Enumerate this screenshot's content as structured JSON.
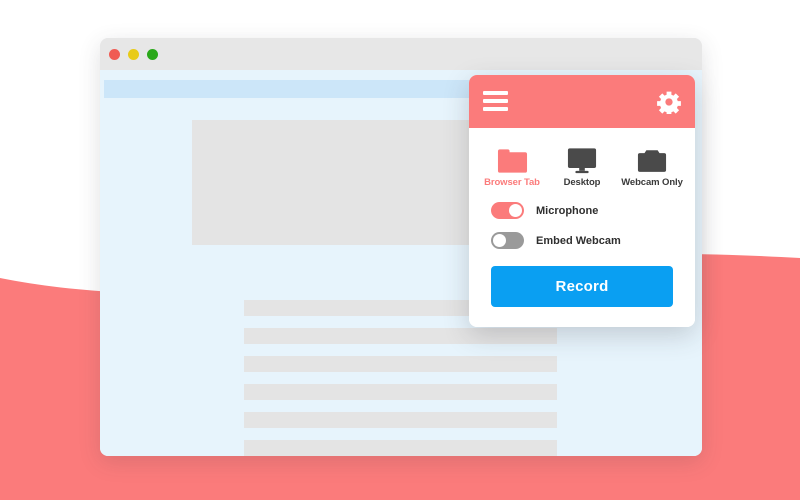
{
  "background": {
    "page_color": "#ffffff",
    "wave_color": "#fb7b7b"
  },
  "browser": {
    "name": "browser-window",
    "titlebar_color": "#e7e7e7",
    "content_color": "#e7f4fc",
    "traffic_lights": [
      {
        "name": "close",
        "color": "#f05c54"
      },
      {
        "name": "minimize",
        "color": "#e8cb18"
      },
      {
        "name": "maximize",
        "color": "#2aa81a"
      }
    ],
    "address_strip_color": "#cce6f9",
    "placeholders": {
      "hero_color": "#e4e4e4",
      "bar_color": "#e4e4e4",
      "bar_count": 6
    }
  },
  "popup": {
    "header": {
      "background": "#fb7b7b",
      "menu_icon": "hamburger-icon",
      "settings_icon": "gear-icon"
    },
    "sources": [
      {
        "id": "browser-tab",
        "label": "Browser Tab",
        "icon": "folder-icon",
        "active": true,
        "color": "#fb7b7b"
      },
      {
        "id": "desktop",
        "label": "Desktop",
        "icon": "monitor-icon",
        "active": false,
        "color": "#4a4a4a"
      },
      {
        "id": "webcam-only",
        "label": "Webcam Only",
        "icon": "camera-icon",
        "active": false,
        "color": "#4a4a4a"
      }
    ],
    "toggles": [
      {
        "id": "microphone",
        "label": "Microphone",
        "state": "on",
        "on_color": "#fb7b7b"
      },
      {
        "id": "embed-webcam",
        "label": "Embed Webcam",
        "state": "off",
        "off_color": "#9a9a9a"
      }
    ],
    "record_button": {
      "label": "Record",
      "color": "#0a9ff2",
      "text_color": "#ffffff"
    }
  }
}
